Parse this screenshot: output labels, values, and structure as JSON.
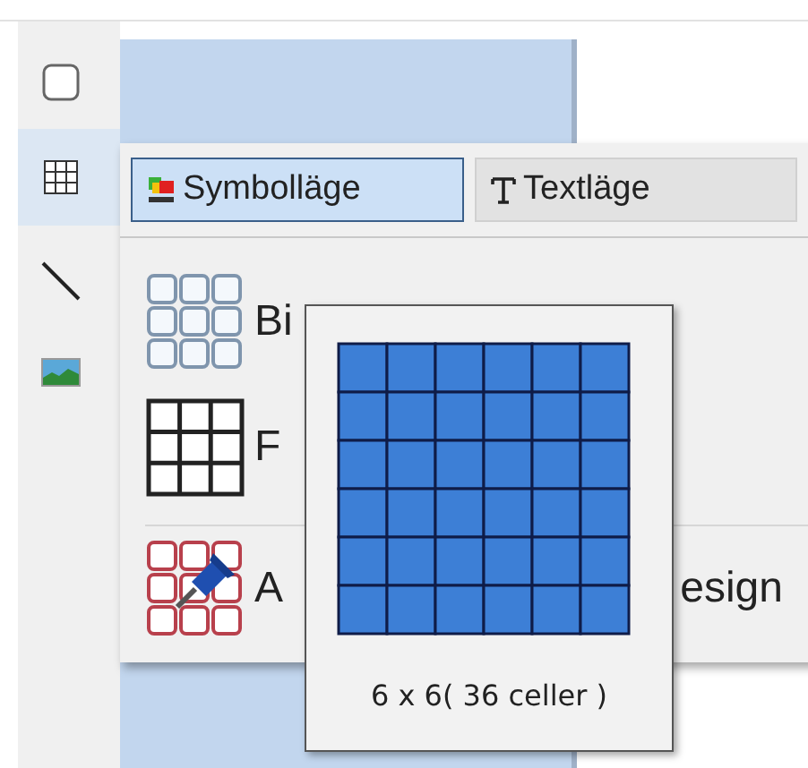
{
  "toolbar": [
    {
      "kind": "shape",
      "selected": false
    },
    {
      "kind": "table",
      "selected": true
    },
    {
      "kind": "line",
      "selected": false
    },
    {
      "kind": "picture",
      "selected": false
    }
  ],
  "menu": {
    "tabs": [
      {
        "kind": "symbol",
        "label": "Symbolläge",
        "selected": true
      },
      {
        "kind": "text",
        "label": "Textläge",
        "selected": false
      }
    ],
    "items": [
      {
        "kind": "grid",
        "label": "Bi"
      },
      {
        "kind": "table",
        "label": "F"
      },
      {
        "kind": "pinned",
        "label": "A",
        "label_end": "esign"
      }
    ]
  },
  "tooltip": {
    "caption": "6 x 6( 36 celler )"
  }
}
